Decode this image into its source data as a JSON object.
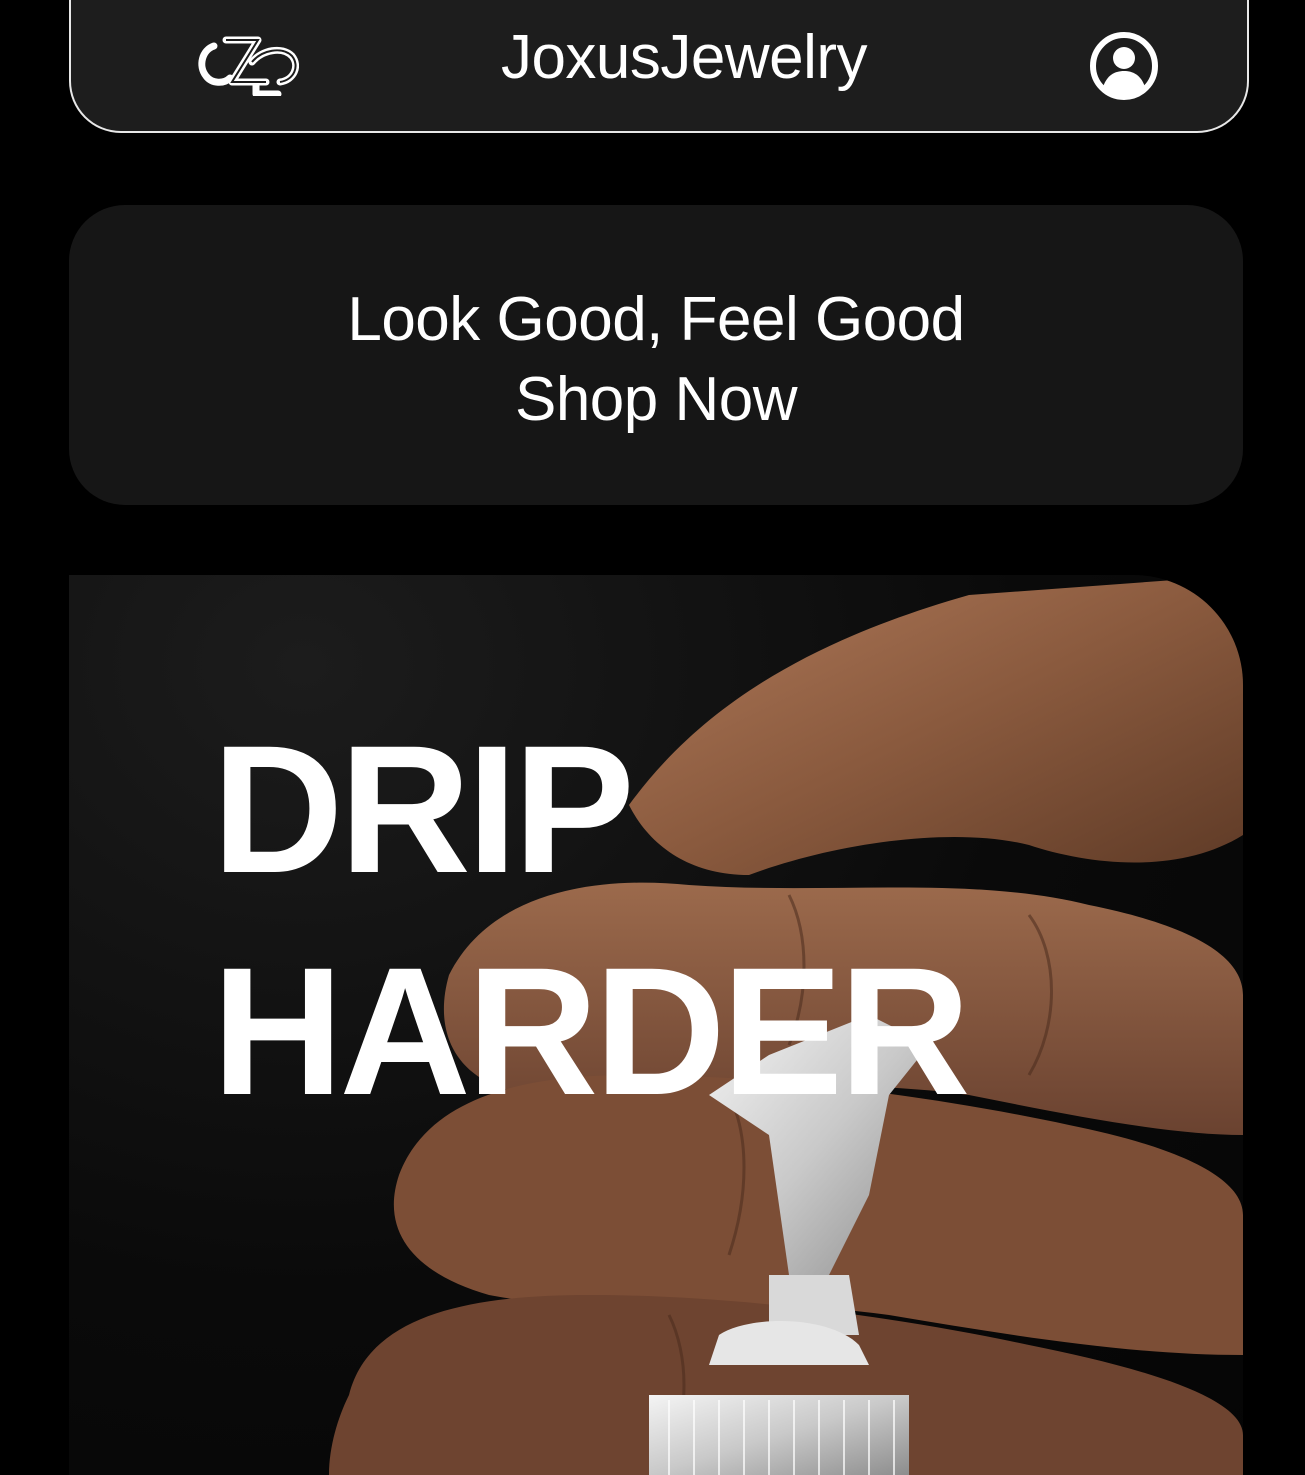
{
  "header": {
    "brand_name": "JoxusJewelry",
    "logo_icon": "jz-monogram-logo",
    "account_icon": "user-account-icon"
  },
  "promo": {
    "line1": "Look Good, Feel Good",
    "line2": "Shop Now"
  },
  "hero": {
    "headline_line1": "DRIP",
    "headline_line2": "HARDER",
    "image_description_icon": "hand-with-diamond-ring-image"
  },
  "colors": {
    "background": "#000000",
    "header_bg": "#1d1d1d",
    "promo_bg": "#161616",
    "text": "#ffffff"
  }
}
